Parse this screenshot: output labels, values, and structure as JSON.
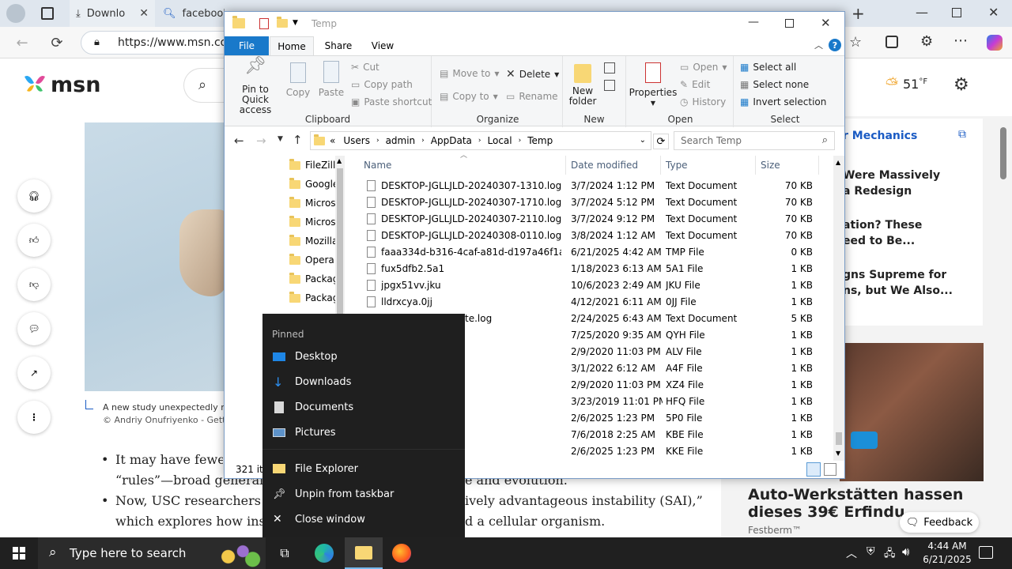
{
  "browser": {
    "tabs": [
      {
        "label": "Downlo",
        "icon": "download-icon"
      },
      {
        "label": "facebook",
        "icon": "search-icon"
      }
    ],
    "url": "https://www.msn.com"
  },
  "msn": {
    "logo_text": "msn",
    "weather": {
      "temp": "51",
      "unit": "°F"
    },
    "caption_line1": "A new study unexpectedly re",
    "caption_line2": "© Andriy Onufriyenko - Getty",
    "body_lines": [
      "It may have fewer",
      "“rules”—broad generaliza",
      "e and evolution.",
      "Now, USC researchers wa",
      "ively advantageous instability (SAI),”",
      "which explores how insta",
      "d a cellular organism."
    ],
    "news_source": "r Mechanics",
    "news_items": [
      [
        "Were Massively",
        "a Redesign"
      ],
      [
        "ation? These",
        "eed to Be..."
      ],
      [
        "gns Supreme for",
        "ns, but We Also..."
      ]
    ],
    "ad_title": "Auto-Werkstätten hassen dieses 39€ Erfindu",
    "ad_source": "Festberm™",
    "feedback_label": "Feedback"
  },
  "explorer": {
    "title": "Temp",
    "ribbon_tabs": [
      "File",
      "Home",
      "Share",
      "View"
    ],
    "groups": {
      "clipboard": {
        "label": "Clipboard",
        "pin": "Pin to Quick access",
        "copy": "Copy",
        "paste": "Paste",
        "cut": "Cut",
        "copy_path": "Copy path",
        "paste_shortcut": "Paste shortcut"
      },
      "organize": {
        "label": "Organize",
        "move_to": "Move to",
        "copy_to": "Copy to",
        "delete": "Delete",
        "rename": "Rename"
      },
      "new": {
        "label": "New",
        "new_folder": "New folder"
      },
      "open": {
        "label": "Open",
        "properties": "Properties",
        "open": "Open",
        "edit": "Edit",
        "history": "History"
      },
      "select": {
        "label": "Select",
        "select_all": "Select all",
        "select_none": "Select none",
        "invert": "Invert selection"
      }
    },
    "breadcrumb": [
      "«",
      "Users",
      "admin",
      "AppData",
      "Local",
      "Temp"
    ],
    "search_placeholder": "Search Temp",
    "nav_items": [
      "FileZilla",
      "Google",
      "Microso",
      "Microso",
      "Mozilla",
      "Opera",
      "Packag",
      "Packag"
    ],
    "columns": [
      "Name",
      "Date modified",
      "Type",
      "Size"
    ],
    "files": [
      {
        "name": "DESKTOP-JGLLJLD-20240307-1310.log",
        "date": "3/7/2024 1:12 PM",
        "type": "Text Document",
        "size": "70 KB"
      },
      {
        "name": "DESKTOP-JGLLJLD-20240307-1710.log",
        "date": "3/7/2024 5:12 PM",
        "type": "Text Document",
        "size": "70 KB"
      },
      {
        "name": "DESKTOP-JGLLJLD-20240307-2110.log",
        "date": "3/7/2024 9:12 PM",
        "type": "Text Document",
        "size": "70 KB"
      },
      {
        "name": "DESKTOP-JGLLJLD-20240308-0110.log",
        "date": "3/8/2024 1:12 AM",
        "type": "Text Document",
        "size": "70 KB"
      },
      {
        "name": "faaa334d-b316-4caf-a81d-d197a46f1a4f.t...",
        "date": "6/21/2025 4:42 AM",
        "type": "TMP File",
        "size": "0 KB"
      },
      {
        "name": "fux5dfb2.5a1",
        "date": "1/18/2023 6:13 AM",
        "type": "5A1 File",
        "size": "1 KB"
      },
      {
        "name": "jpgx51vv.jku",
        "date": "10/6/2023 2:49 AM",
        "type": "JKU File",
        "size": "1 KB"
      },
      {
        "name": "lldrxcya.0jj",
        "date": "4/12/2021 6:11 AM",
        "type": "0JJ File",
        "size": "1 KB"
      },
      {
        "name": "te.log",
        "date": "2/24/2025 6:43 AM",
        "type": "Text Document",
        "size": "5 KB"
      },
      {
        "name": "",
        "date": "7/25/2020 9:35 AM",
        "type": "QYH File",
        "size": "1 KB"
      },
      {
        "name": "",
        "date": "2/9/2020 11:03 PM",
        "type": "ALV File",
        "size": "1 KB"
      },
      {
        "name": "",
        "date": "3/1/2022 6:12 AM",
        "type": "A4F File",
        "size": "1 KB"
      },
      {
        "name": "",
        "date": "2/9/2020 11:03 PM",
        "type": "XZ4 File",
        "size": "1 KB"
      },
      {
        "name": "",
        "date": "3/23/2019 11:01 PM",
        "type": "HFQ File",
        "size": "1 KB"
      },
      {
        "name": "",
        "date": "2/6/2025 1:23 PM",
        "type": "5P0 File",
        "size": "1 KB"
      },
      {
        "name": "",
        "date": "7/6/2018 2:25 AM",
        "type": "KBE File",
        "size": "1 KB"
      },
      {
        "name": "",
        "date": "2/6/2025 1:23 PM",
        "type": "KKE File",
        "size": "1 KB"
      }
    ],
    "status": "321 ite"
  },
  "jumplist": {
    "header": "Pinned",
    "pinned": [
      {
        "label": "Desktop",
        "icon": "desktop-icon"
      },
      {
        "label": "Downloads",
        "icon": "downloads-icon"
      },
      {
        "label": "Documents",
        "icon": "documents-icon"
      },
      {
        "label": "Pictures",
        "icon": "pictures-icon"
      }
    ],
    "actions": [
      {
        "label": "File Explorer",
        "icon": "file-explorer-icon"
      },
      {
        "label": "Unpin from taskbar",
        "icon": "unpin-icon"
      },
      {
        "label": "Close window",
        "icon": "close-icon"
      }
    ]
  },
  "taskbar": {
    "search_placeholder": "Type here to search",
    "time": "4:44 AM",
    "date": "6/21/2025"
  }
}
